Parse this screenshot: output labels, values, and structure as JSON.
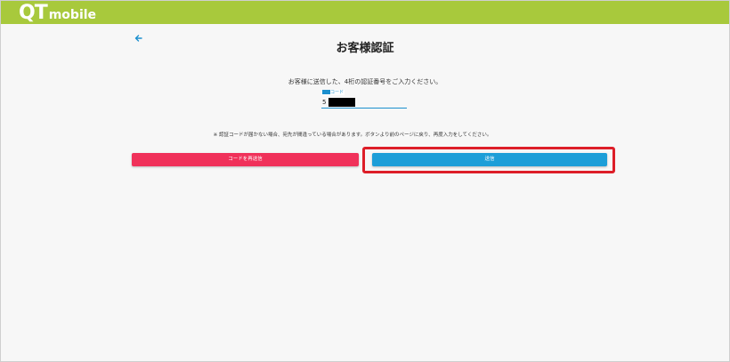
{
  "header": {
    "logo_q": "Q",
    "logo_t": "T",
    "logo_mobile": "mobile",
    "color": "#a8c93c"
  },
  "nav": {
    "back_icon": "arrow-left-icon"
  },
  "page": {
    "title": "お客様認証",
    "instruction": "お客様に送信した、4桁の認証番号をご入力ください。",
    "notice": "※ 認証コードが届かない場合、宛先が間違っている場合があります。ボタンより前のページに戻り、再度入力をしてください。"
  },
  "code_field": {
    "label": "コード",
    "value": "5"
  },
  "buttons": {
    "resend_label": "コードを再送信",
    "send_label": "送信"
  },
  "colors": {
    "resend": "#f0315a",
    "send": "#1c9ed8",
    "highlight": "#dd1e28",
    "accent": "#1b8fce"
  }
}
